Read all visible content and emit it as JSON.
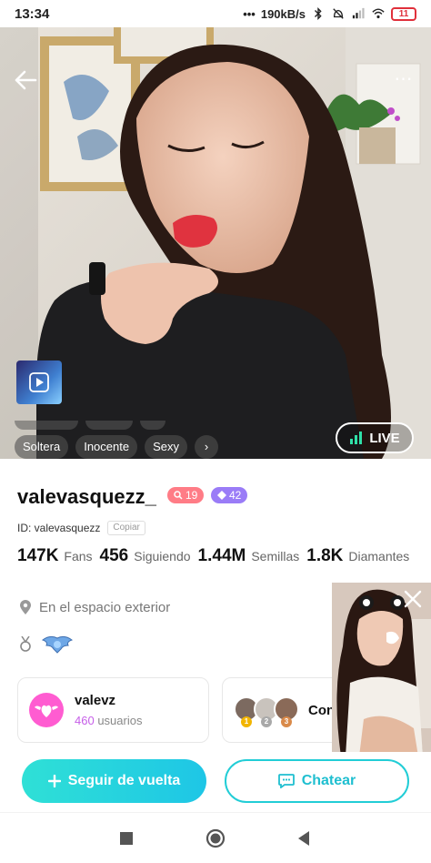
{
  "status_bar": {
    "time": "13:34",
    "speed": "190kB/s",
    "battery": "11"
  },
  "hero": {
    "tags": [
      "Soltera",
      "Inocente",
      "Sexy"
    ],
    "live_label": "LIVE",
    "page_count": 4,
    "active_page": 3
  },
  "profile": {
    "username": "valevasquezz_",
    "level": "19",
    "diamond_level": "42",
    "id_label": "ID: valevasquezz",
    "copy_label": "Copiar",
    "stats": [
      {
        "value": "147K",
        "label": "Fans"
      },
      {
        "value": "456",
        "label": "Siguiendo"
      },
      {
        "value": "1.44M",
        "label": "Semillas"
      },
      {
        "value": "1.8K",
        "label": "Diamantes"
      }
    ],
    "location": "En el espacio exterior"
  },
  "fan_club": {
    "name": "valevz",
    "count": "460",
    "count_label": "usuarios"
  },
  "contributors": {
    "label": "Con",
    "ranks": [
      "1",
      "2",
      "3"
    ]
  },
  "actions": {
    "follow_label": "Seguir de vuelta",
    "chat_label": "Chatear"
  },
  "colors": {
    "accent": "#1ec6e6",
    "level_badge": "#ff7c86",
    "diamond_badge": "#9a7cf7",
    "fan_avatar": "#ff5cd1"
  }
}
